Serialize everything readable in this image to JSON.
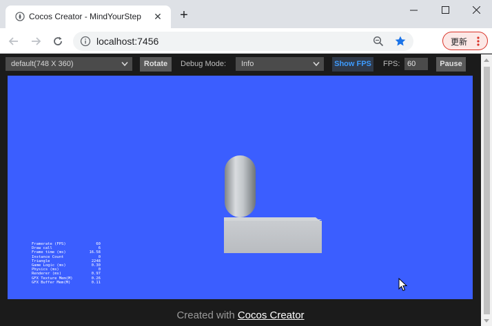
{
  "browser": {
    "tab_title": "Cocos Creator - MindYourStep",
    "url": "localhost:7456",
    "update_label": "更新"
  },
  "preview": {
    "device_select": "default(748 X 360)",
    "rotate_label": "Rotate",
    "debug_mode_label": "Debug Mode:",
    "debug_mode_value": "Info",
    "show_fps_label": "Show FPS",
    "fps_label": "FPS:",
    "fps_value": "60",
    "pause_label": "Pause"
  },
  "stats": [
    {
      "label": "Framerate (FPS)",
      "value": "60"
    },
    {
      "label": "Draw call",
      "value": "6"
    },
    {
      "label": "Frame time (ms)",
      "value": "16.58"
    },
    {
      "label": "Instance Count",
      "value": "0"
    },
    {
      "label": "Triangle",
      "value": "2248"
    },
    {
      "label": "Game Logic (ms)",
      "value": "0.30"
    },
    {
      "label": "Physics (ms)",
      "value": "0"
    },
    {
      "label": "Renderer (ms)",
      "value": "0.97"
    },
    {
      "label": "GFX Texture Mem(M)",
      "value": "0.26"
    },
    {
      "label": "GFX Buffer Mem(M)",
      "value": "0.11"
    }
  ],
  "footer": {
    "prefix": "Created with ",
    "link": "Cocos Creator"
  },
  "colors": {
    "game_background": "#3b5eff",
    "accent_blue": "#1a73e8",
    "update_red": "#d93025"
  }
}
